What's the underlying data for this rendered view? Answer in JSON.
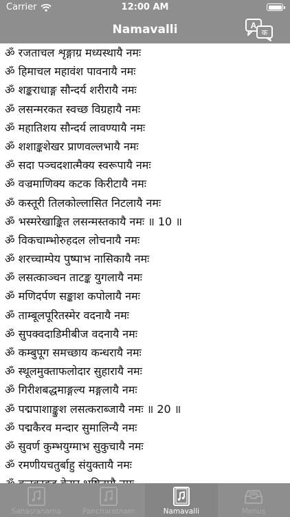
{
  "status": {
    "carrier": "Carrier",
    "time": "12:00 AM"
  },
  "nav": {
    "title": "Namavalli",
    "translate_icon": "translate-icon"
  },
  "names": [
    "ॐ रजताचल शृङ्गाग्र मध्यस्थायै नमः",
    "ॐ हिमाचल महावंश पावनायै नमः",
    "ॐ शङ्कराधाङ्ग सौन्दर्य शरीरायै नमः",
    "ॐ लसन्मरकत स्वच्छ विग्रहायै नमः",
    "ॐ महातिशय सौन्दर्य लावण्यायै नमः",
    "ॐ शशाङ्कशेखर प्राणवल्लभायै नमः",
    "ॐ सदा पञ्चदशात्मैक्य स्वरूपायै नमः",
    "ॐ वज्रमाणिक्य कटक किरीटायै नमः",
    "ॐ कस्तूरी तिलकोल्लासित निटलायै नमः",
    "ॐ भस्मरेखाङ्कित लसन्मस्तकायै नमः ॥ 10 ॥",
    "ॐ विकचाम्भोरुहदल लोचनायै नमः",
    "ॐ शरच्चाम्पेय पुष्पाभ नासिकायै नमः",
    "ॐ लसत्काञ्चन ताटङ्क युगलायै नमः",
    "ॐ मणिदर्पण सङ्काश कपोलायै नमः",
    "ॐ ताम्बूलपूरितस्मेर वदनायै नमः",
    "ॐ सुपक्वदाडिमीबीज वदनायै नमः",
    "ॐ कम्बुपूग समच्छाय कन्धरायै नमः",
    "ॐ स्थूलमुक्ताफलोदार सुहारायै नमः",
    "ॐ गिरीशबद्धमाङ्गल्य मङ्गलायै नमः",
    "ॐ पद्मपाशाङ्कुश लसत्कराब्जायै नमः ॥ 20 ॥",
    "ॐ पद्मकैरव मन्दार सुमालिन्यै नमः",
    "ॐ सुवर्ण कुम्भयुग्माभ सुकुचायै नमः",
    "ॐ रमणीयचतुर्बाहु संयुक्तायै नमः",
    "ॐ कनकाङ्गद केयूर भूषितायै नमः"
  ],
  "tabs": [
    {
      "label": "Sahasranama",
      "icon": "music-file-icon",
      "active": false
    },
    {
      "label": "Pancharatnam",
      "icon": "music-file-icon",
      "active": false
    },
    {
      "label": "Namavalli",
      "icon": "music-book-icon",
      "active": true
    },
    {
      "label": "Menus",
      "icon": "tray-icon",
      "active": false
    }
  ]
}
